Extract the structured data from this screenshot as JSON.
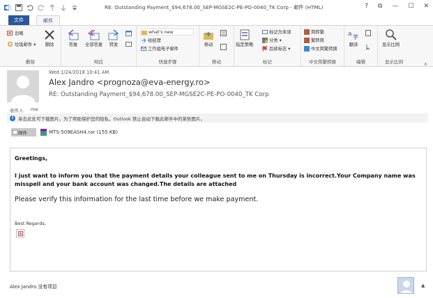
{
  "window": {
    "title": "RE: Outstanding Payment_$94,678.00_SEP-MGSE2C-PE-PO-0040_TK Corp - 邮件 (HTML)",
    "buttons": {
      "help": "?",
      "restore": "⧉",
      "minimize": "—",
      "maximize": "☐",
      "close": "✕"
    }
  },
  "tabs": {
    "file": "文件",
    "message": "邮件"
  },
  "ribbon": {
    "delete_group": {
      "ignore": "忽略",
      "junk": "垃圾邮件 ▾",
      "delete": "删除",
      "label": "删除"
    },
    "respond_group": {
      "reply": "答复",
      "reply_all": "全部答复",
      "forward": "转发",
      "label": "响应"
    },
    "quick_steps": {
      "item1": "what's new",
      "item2": "给经理",
      "item3": "工作组电子邮件",
      "label": "快速步骤"
    },
    "move_group": {
      "move": "移动",
      "label": "移动"
    },
    "tags_group": {
      "policy": "指定策略",
      "mark_unread": "标记为未读",
      "categorize": "分类 ▾",
      "follow_up": "后续标志 ▾",
      "label": "标记"
    },
    "chinese_group": {
      "to_traditional": "简转繁",
      "to_simplified": "繁转简",
      "convert": "中文简繁转换",
      "label": "中文简繁转换"
    },
    "edit_group": {
      "translate": "翻译",
      "label": "编辑"
    },
    "zoom_group": {
      "zoom": "显示比例",
      "label": "显示比例"
    },
    "collapse": "∧"
  },
  "header": {
    "date": "Wed 1/24/2018 10:41 AM",
    "from": "Alex Jandro <prognoza@eva-energy.ro>",
    "subject": "RE: Outstanding Payment_$94,678.00_SEP-MGSE2C-PE-PO-0040_TK Corp",
    "to_label": "收件人",
    "to_value": "me",
    "info": "单击此处可下载图片。为了帮助保护您的隐私，Outlook 禁止自动下载此邮件中的某些图片。",
    "message_tab": "邮件",
    "attachment": "MTS-509EASH4.rar (155 KB)"
  },
  "body": {
    "greeting": "Greetings,",
    "paragraph1": "I just want to inform you that the payment details your colleague sent to me on Thursday is incorrect.Your Company name was misspell and your bank account was changed.The details are attached",
    "paragraph2": "Please verify this information for the last time before we make payment.",
    "regards": "Best Regards,"
  },
  "statusbar": {
    "text": "Alex Jandro 没有项目",
    "expand": "▲"
  }
}
